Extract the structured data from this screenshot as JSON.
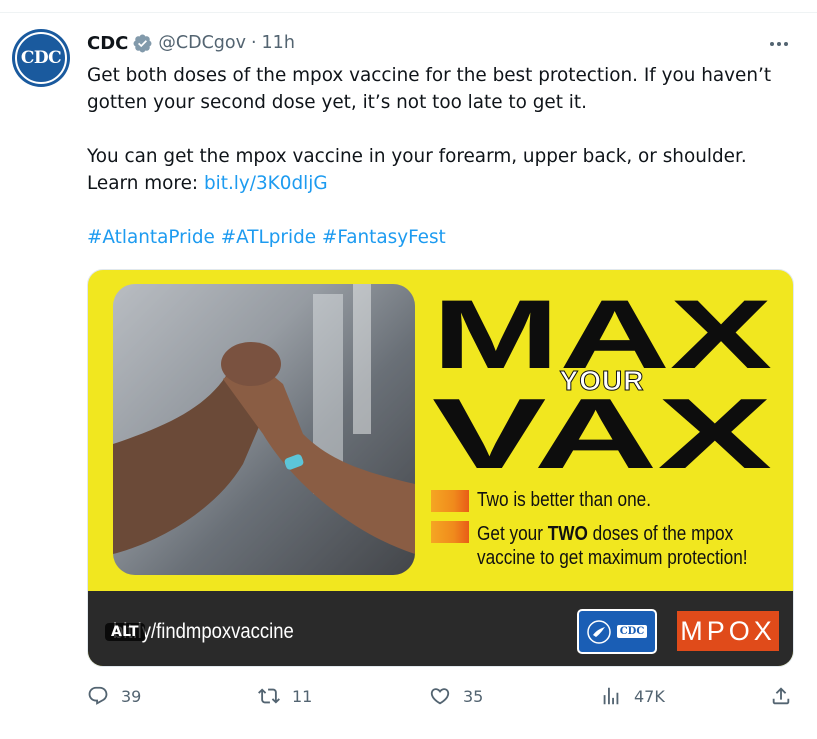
{
  "tweet": {
    "author_name": "CDC",
    "handle": "@CDCgov",
    "separator": "·",
    "time": "11h",
    "avatar_text": "CDC",
    "lines": [
      "Get both doses of the mpox vaccine for the best protection. If you haven’t",
      "gotten your second dose yet, it’s not too late to get it.",
      "You can get the mpox vaccine in your forearm, upper back, or shoulder."
    ],
    "learn_more_label": "Learn more:",
    "learn_more_link": "bit.ly/3K0dljG",
    "hashtags": [
      "#AtlantaPride",
      "#ATLpride",
      "#FantasyFest"
    ]
  },
  "media": {
    "headline_top": "MAX",
    "headline_middle": "YOUR",
    "headline_bottom": "VAX",
    "tagline_1": "Two is better than one.",
    "tagline_2_pre": "Get your ",
    "tagline_2_bold": "TWO",
    "tagline_2_post": " doses of the mpox",
    "tagline_3": "vaccine to get maximum protection!",
    "url_text": "bit.ly/findmpoxvaccine",
    "alt_badge": "ALT",
    "hhs_cdc_text": "CDC",
    "mpox_badge": "MPOX"
  },
  "actions": {
    "replies": "39",
    "retweets": "11",
    "likes": "35",
    "views": "47K"
  },
  "colors": {
    "link": "#1d9bf0",
    "secondary_text": "#536471",
    "media_yellow": "#f1e71f",
    "mpox_orange": "#e04b1a",
    "verified_gray": "#829aab"
  },
  "icons": [
    "verified-badge-icon",
    "more-icon",
    "reply-icon",
    "retweet-icon",
    "like-icon",
    "views-icon",
    "share-icon"
  ]
}
